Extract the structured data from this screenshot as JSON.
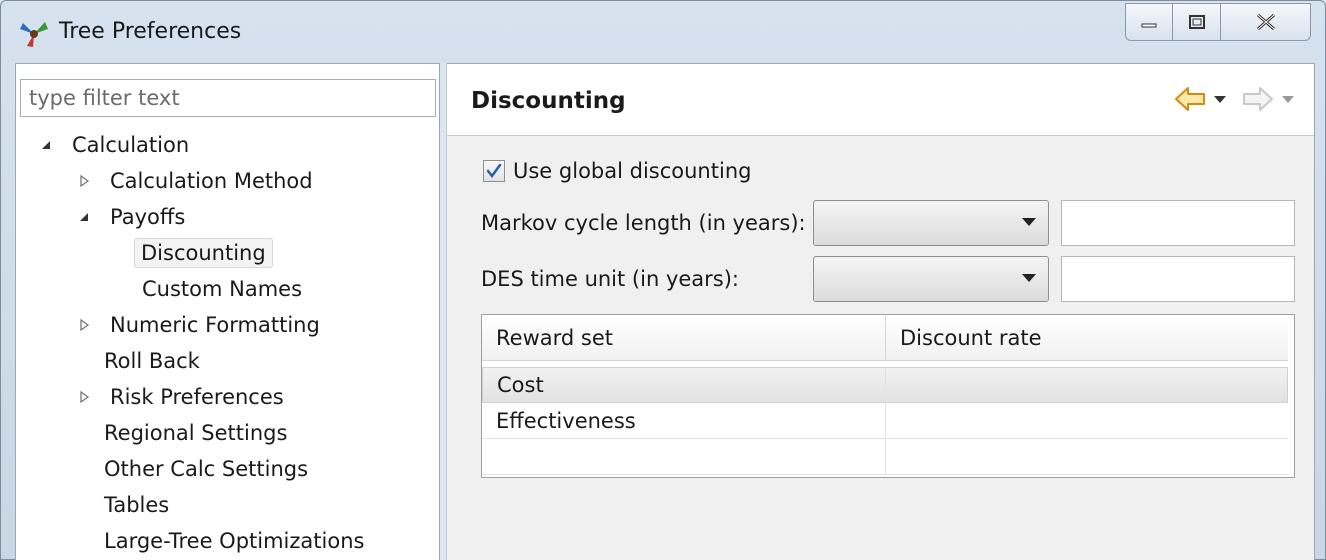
{
  "window": {
    "title": "Tree Preferences"
  },
  "filter": {
    "placeholder": "type filter text"
  },
  "tree": {
    "items": [
      {
        "label": "Calculation",
        "expanded": true
      },
      {
        "label": "Calculation Method",
        "expanded": false
      },
      {
        "label": "Payoffs",
        "expanded": true
      },
      {
        "label": "Discounting",
        "selected": true
      },
      {
        "label": "Custom Names"
      },
      {
        "label": "Numeric Formatting",
        "expanded": false
      },
      {
        "label": "Roll Back"
      },
      {
        "label": "Risk Preferences",
        "expanded": false
      },
      {
        "label": "Regional Settings"
      },
      {
        "label": "Other Calc Settings"
      },
      {
        "label": "Tables"
      },
      {
        "label": "Large-Tree Optimizations"
      }
    ]
  },
  "page": {
    "title": "Discounting",
    "use_global_discounting": {
      "label": "Use global discounting",
      "checked": true
    },
    "markov_cycle": {
      "label": "Markov cycle length (in years):",
      "selected": "",
      "value": ""
    },
    "des_time_unit": {
      "label": "DES time unit (in years):",
      "selected": "",
      "value": ""
    },
    "table": {
      "columns": [
        "Reward set",
        "Discount rate"
      ],
      "rows": [
        {
          "reward_set": "Cost",
          "discount_rate": "",
          "selected": true
        },
        {
          "reward_set": "Effectiveness",
          "discount_rate": ""
        },
        {
          "reward_set": "",
          "discount_rate": ""
        }
      ]
    }
  },
  "colors": {
    "back_arrow": "#e8a01c",
    "forward_arrow_disabled": "#c8c8c8",
    "checkbox_check": "#2a5ea8"
  }
}
